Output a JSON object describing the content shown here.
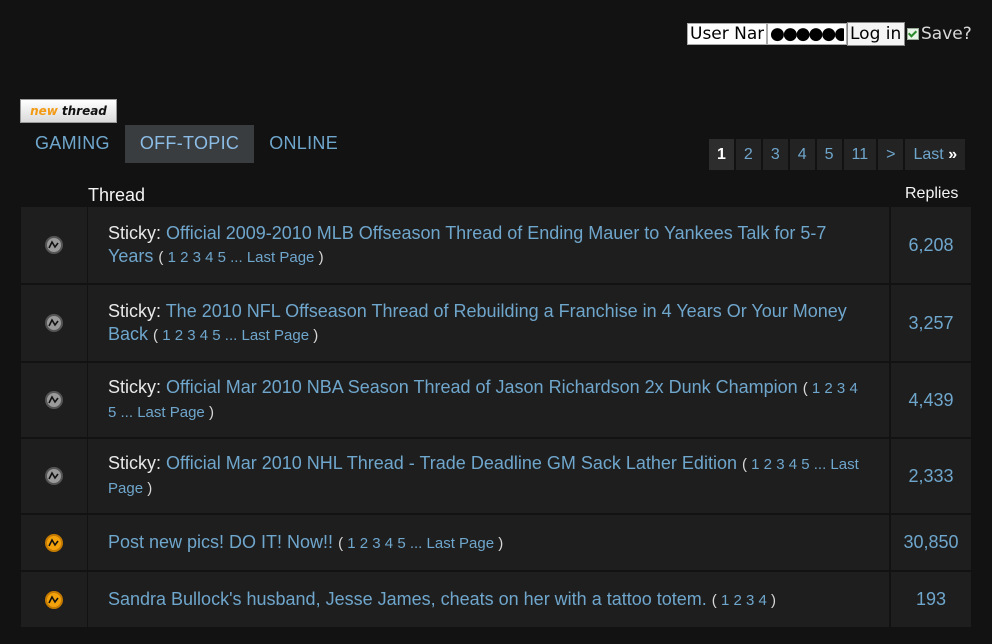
{
  "login": {
    "username_value": "User Name",
    "password_value": "●●●●●●●●",
    "login_label": "Log in",
    "save_label": "Save?"
  },
  "new_thread": {
    "word1": "new",
    "word2": "thread"
  },
  "tabs": [
    {
      "label": "GAMING",
      "active": false
    },
    {
      "label": "OFF-TOPIC",
      "active": true
    },
    {
      "label": "ONLINE",
      "active": false
    }
  ],
  "pagination": {
    "current": "1",
    "pages": [
      "2",
      "3",
      "4",
      "5",
      "11"
    ],
    "next": ">",
    "last": "Last",
    "last_arrow": "»"
  },
  "columns": {
    "thread": "Thread",
    "replies": "Replies"
  },
  "threads": [
    {
      "prefix": "Sticky:",
      "title": "Official 2009-2010 MLB Offseason Thread of Ending Mauer to Yankees Talk for 5-7 Years",
      "pages": [
        "1",
        "2",
        "3",
        "4",
        "5"
      ],
      "ellipsis": "...",
      "last_page": "Last Page",
      "replies": "6,208",
      "icon": "sticky-thread-icon"
    },
    {
      "prefix": "Sticky:",
      "title": "The 2010 NFL Offseason Thread of Rebuilding a Franchise in 4 Years Or Your Money Back",
      "pages": [
        "1",
        "2",
        "3",
        "4",
        "5"
      ],
      "ellipsis": "...",
      "last_page": "Last Page",
      "replies": "3,257",
      "icon": "sticky-thread-icon"
    },
    {
      "prefix": "Sticky:",
      "title": "Official Mar 2010 NBA Season Thread of Jason Richardson 2x Dunk Champion",
      "pages": [
        "1",
        "2",
        "3",
        "4",
        "5"
      ],
      "ellipsis": "...",
      "last_page": "Last Page",
      "replies": "4,439",
      "icon": "sticky-thread-icon"
    },
    {
      "prefix": "Sticky:",
      "title": "Official Mar 2010 NHL Thread - Trade Deadline GM Sack Lather Edition",
      "pages": [
        "1",
        "2",
        "3",
        "4",
        "5"
      ],
      "ellipsis": "...",
      "last_page": "Last Page",
      "replies": "2,333",
      "icon": "sticky-thread-icon"
    },
    {
      "prefix": "",
      "title": "Post new pics! DO IT! Now!!",
      "pages": [
        "1",
        "2",
        "3",
        "4",
        "5"
      ],
      "ellipsis": "...",
      "last_page": "Last Page",
      "replies": "30,850",
      "icon": "hot-thread-icon"
    },
    {
      "prefix": "",
      "title": "Sandra Bullock's husband, Jesse James, cheats on her with a tattoo totem.",
      "pages": [
        "1",
        "2",
        "3",
        "4"
      ],
      "ellipsis": "",
      "last_page": "",
      "replies": "193",
      "icon": "hot-thread-icon"
    }
  ]
}
